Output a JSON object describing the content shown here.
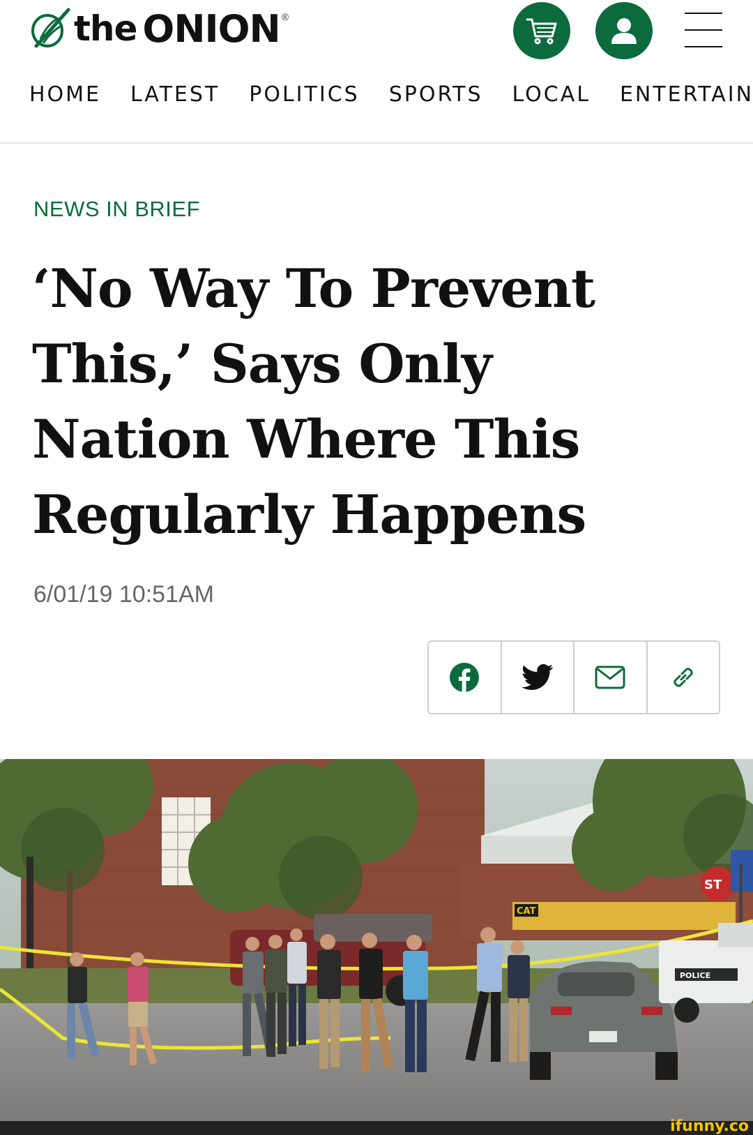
{
  "header": {
    "logo_the": "the",
    "logo_name": "ONION",
    "logo_reg": "®",
    "brand_color": "#0c6b3c",
    "icons": [
      "cart-icon",
      "user-icon",
      "menu-icon"
    ]
  },
  "nav": {
    "items": [
      {
        "label": "HOME"
      },
      {
        "label": "LATEST"
      },
      {
        "label": "POLITICS"
      },
      {
        "label": "SPORTS"
      },
      {
        "label": "LOCAL"
      },
      {
        "label": "ENTERTAINM"
      }
    ]
  },
  "article": {
    "kicker": "NEWS IN BRIEF",
    "headline": "‘No Way To Prevent This,’ Says Only Nation Where This Regularly Happens",
    "dateline": "6/01/19 10:51AM",
    "share_buttons": [
      "facebook-icon",
      "twitter-icon",
      "email-icon",
      "link-icon"
    ]
  },
  "photo": {
    "sign_cat": "CAT",
    "sign_stop": "ST",
    "car_badge": "POLICE"
  },
  "watermark": "ifunny.co"
}
